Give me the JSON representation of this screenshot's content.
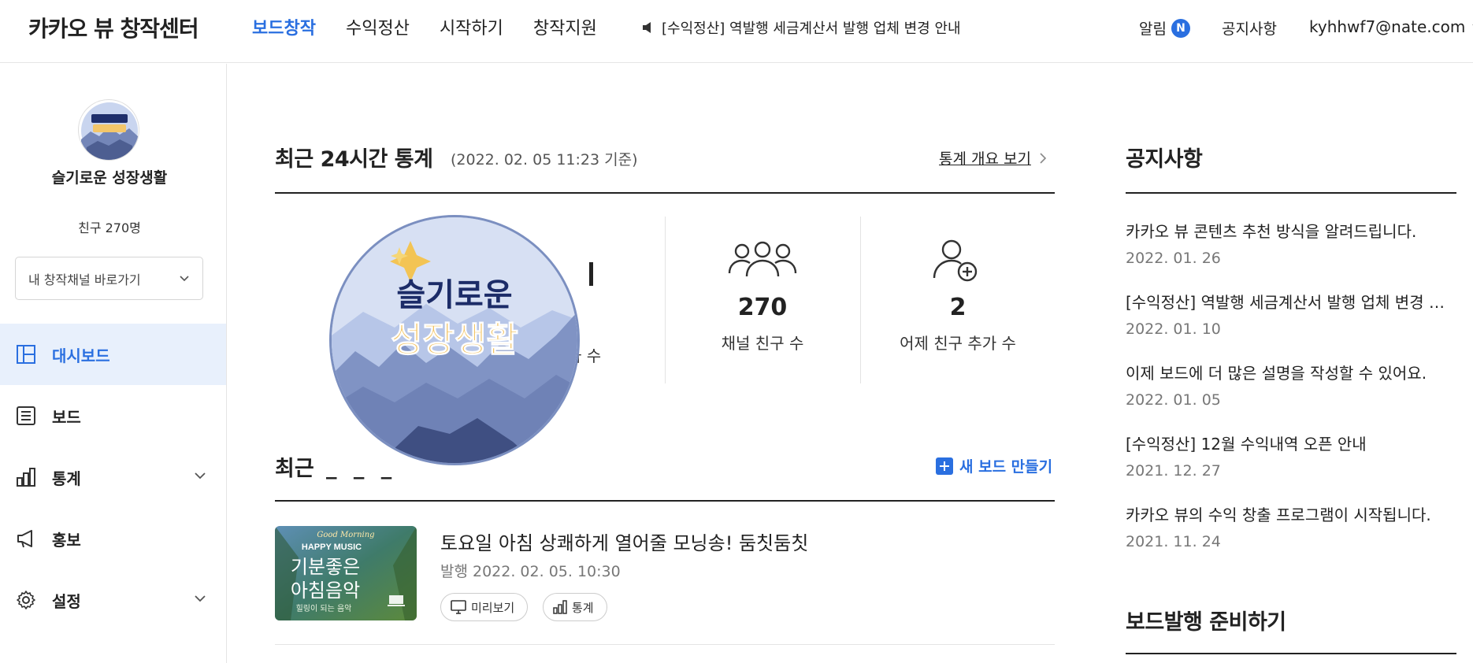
{
  "header": {
    "logo": "카카오 뷰 창작센터",
    "nav": [
      "보드창작",
      "수익정산",
      "시작하기",
      "창작지원"
    ],
    "ticker": "[수익정산] 역발행 세금계산서 발행 업체 변경 안내",
    "alarm_label": "알림",
    "alarm_badge": "N",
    "notice_label": "공지사항",
    "account": "kyhhwf7@nate.com"
  },
  "sidebar": {
    "channel_name": "슬기로운 성장생활",
    "friend_count": "친구 270명",
    "channel_select": "내 창작채널 바로가기",
    "menu": [
      {
        "label": "대시보드",
        "icon": "dashboard-icon",
        "active": true
      },
      {
        "label": "보드",
        "icon": "list-icon"
      },
      {
        "label": "통계",
        "icon": "bar-chart-icon",
        "expandable": true
      },
      {
        "label": "홍보",
        "icon": "megaphone-icon"
      },
      {
        "label": "설정",
        "icon": "gear-icon",
        "expandable": true
      }
    ]
  },
  "stats": {
    "title": "최근 24시간 통계",
    "subtitle": "(2022. 02. 05 11:23 기준)",
    "overview_link": "통계 개요 보기",
    "partial_label": "가 수",
    "items": [
      {
        "value": "270",
        "label": "채널 친구 수",
        "icon": "friends-group-icon"
      },
      {
        "value": "2",
        "label": "어제 친구 추가 수",
        "icon": "add-friend-icon"
      }
    ]
  },
  "overlay": {
    "line1": "슬기로운",
    "line2": "성장생활"
  },
  "recent": {
    "title": "최근",
    "dashes": "_ _ _",
    "new_board": "새 보드 만들기",
    "board": {
      "title": "토요일 아침 상쾌하게 열어줄 모닝송! 둠칫둠칫",
      "date": "발행 2022. 02. 05. 10:30",
      "preview_btn": "미리보기",
      "stats_btn": "통계",
      "thumb": {
        "small": "Good Morning",
        "music": "HAPPY MUSIC",
        "line1": "기분좋은",
        "line2": "아침음악",
        "caption": "힐링이 되는 음악"
      }
    }
  },
  "notices": {
    "title": "공지사항",
    "items": [
      {
        "text": "카카오 뷰 콘텐츠 추천 방식을 알려드립니다.",
        "date": "2022. 01. 26"
      },
      {
        "text": "[수익정산] 역발행 세금계산서 발행 업체 변경 …",
        "date": "2022. 01. 10"
      },
      {
        "text": "이제 보드에 더 많은 설명을 작성할 수 있어요.",
        "date": "2022. 01. 05"
      },
      {
        "text": "[수익정산] 12월 수익내역 오픈 안내",
        "date": "2021. 12. 27"
      },
      {
        "text": "카카오 뷰의 수익 창출 프로그램이 시작됩니다.",
        "date": "2021. 11. 24"
      }
    ]
  },
  "prepare": {
    "title": "보드발행 준비하기"
  },
  "colors": {
    "accent": "#2a6fe0",
    "active_bg": "#e8f0fc"
  }
}
